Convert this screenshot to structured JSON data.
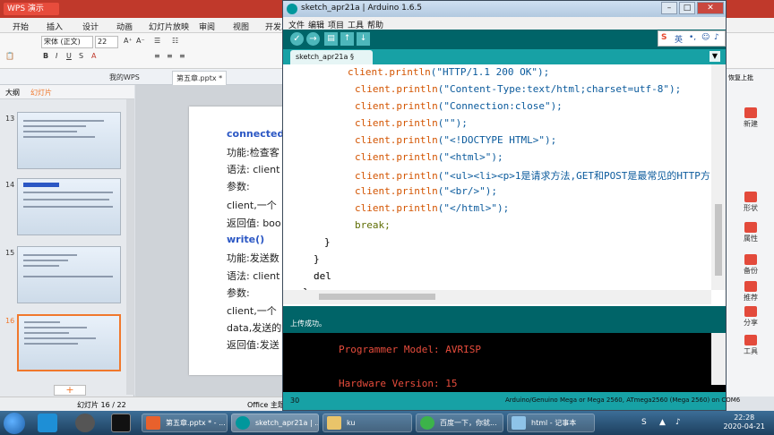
{
  "wps": {
    "logo": "WPS 演示",
    "menu": [
      "开始",
      "插入",
      "设计",
      "动画",
      "幻灯片放映",
      "审阅",
      "视图",
      "开发工"
    ],
    "font_name": "宋体 (正文)",
    "font_size": "22",
    "tabs": [
      "我的WPS",
      "第五章.pptx *"
    ],
    "panel_tabs": [
      "大纲",
      "幻灯片"
    ],
    "slide_numbers": [
      "13",
      "14",
      "15",
      "16"
    ],
    "slide_lines": [
      "connected()",
      "功能:检查客",
      "语法: client",
      "参数:",
      "client,一个",
      "返回值: boo",
      "write()",
      "功能:发送数",
      "语法: client",
      "参数:",
      "client,一个",
      "data,发送的",
      "返回值:发送"
    ],
    "status_slide": "幻灯片 16 / 22",
    "status_theme": "Office 主题",
    "right_panel": [
      "新建",
      "形状",
      "属性",
      "备份",
      "推荐",
      "分享",
      "工具"
    ],
    "right_top": "恢复上批"
  },
  "arduino": {
    "title": "sketch_apr21a | Arduino 1.6.5",
    "menu": [
      "文件",
      "编辑",
      "项目",
      "工具",
      "帮助"
    ],
    "ime": [
      "S",
      "英"
    ],
    "sketch_tab": "sketch_apr21a §",
    "code_lines": [
      {
        "kw": "client",
        "fn": ".println",
        "arg": "(\"HTTP/1.1 200 OK\");"
      },
      {
        "kw": "client",
        "fn": ".println",
        "arg": "(\"Content-Type:text/html;charset=utf-8\");"
      },
      {
        "kw": "client",
        "fn": ".println",
        "arg": "(\"Connection:close\");"
      },
      {
        "kw": "client",
        "fn": ".println",
        "arg": "(\"\");"
      },
      {
        "kw": "client",
        "fn": ".println",
        "arg": "(\"<!DOCTYPE HTML>\");"
      },
      {
        "kw": "client",
        "fn": ".println",
        "arg": "(\"<html>\");"
      },
      {
        "kw": "client",
        "fn": ".println",
        "arg": "(\"<ul><li><p>1是请求方法,GET和POST是最常见的HTTP方"
      },
      {
        "kw": "client",
        "fn": ".println",
        "arg": "(\"<br/>\");"
      },
      {
        "kw": "client",
        "fn": ".println",
        "arg": "(\"</html>\");"
      }
    ],
    "break_line": "break;",
    "brace1": "}",
    "brace2": "}",
    "typing": "del",
    "brace3": "}",
    "message": "上传成功。",
    "console": [
      "Programmer Model: AVRISP",
      "Hardware Version: 15"
    ],
    "status_line": "30",
    "status_board": "Arduino/Genuino Mega or Mega 2560, ATmega2560 (Mega 2560) on COM6"
  },
  "taskbar": {
    "buttons": [
      "第五章.pptx * - ...",
      "sketch_apr21a | ...",
      "ku",
      "百度一下，你就...",
      "html - 记事本"
    ],
    "time": "22:28",
    "date": "2020-04-21"
  }
}
